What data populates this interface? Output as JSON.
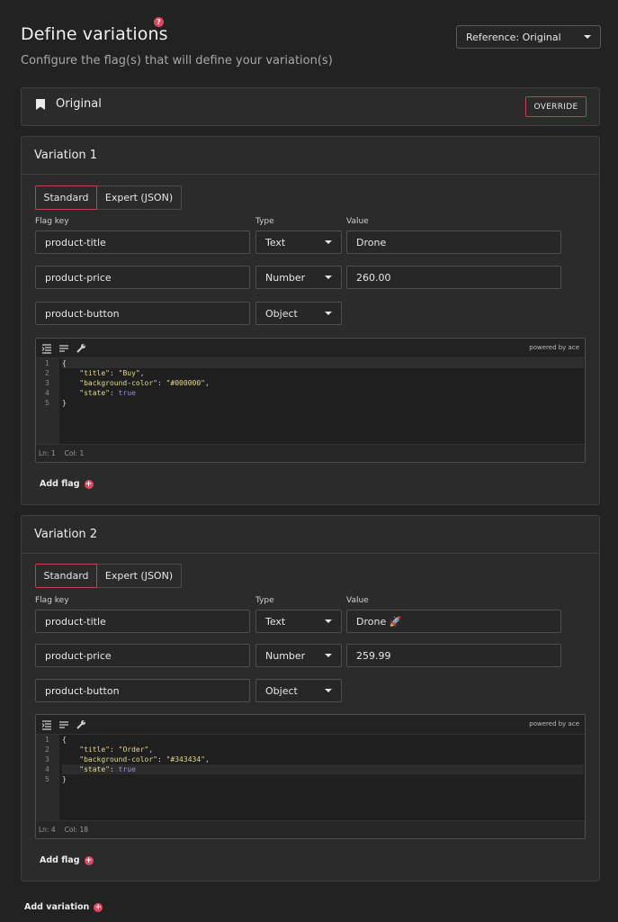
{
  "header": {
    "title": "Define variations",
    "help_badge": "?",
    "subtitle": "Configure the flag(s) that will define your variation(s)",
    "reference_select": "Reference: Original"
  },
  "original": {
    "label": "Original",
    "override_label": "OVERRIDE"
  },
  "labels": {
    "flag_key": "Flag key",
    "type": "Type",
    "value": "Value",
    "tab_standard": "Standard",
    "tab_expert": "Expert (JSON)",
    "powered_by": "powered by ace",
    "add_flag": "Add flag",
    "add_variation": "Add variation"
  },
  "variations": [
    {
      "title": "Variation 1",
      "flags": [
        {
          "key": "product-title",
          "type": "Text",
          "value": "Drone"
        },
        {
          "key": "product-price",
          "type": "Number",
          "value": "260.00"
        },
        {
          "key": "product-button",
          "type": "Object"
        }
      ],
      "editor": {
        "line_numbers": [
          "1",
          "2",
          "3",
          "4",
          "5"
        ],
        "title_value": "\"Buy\"",
        "bg_value": "\"#000000\"",
        "state_value": "true",
        "status_ln": "Ln: 1",
        "status_col": "Col: 1"
      }
    },
    {
      "title": "Variation 2",
      "flags": [
        {
          "key": "product-title",
          "type": "Text",
          "value": "Drone 🚀"
        },
        {
          "key": "product-price",
          "type": "Number",
          "value": "259.99"
        },
        {
          "key": "product-button",
          "type": "Object"
        }
      ],
      "editor": {
        "line_numbers": [
          "1",
          "2",
          "3",
          "4",
          "5"
        ],
        "title_value": "\"Order\"",
        "bg_value": "\"#343434\"",
        "state_value": "true",
        "status_ln": "Ln: 4",
        "status_col": "Col: 18"
      }
    }
  ],
  "colors": {
    "accent": "#e0475f",
    "background": "#222222",
    "panel": "#2b2b2b"
  }
}
